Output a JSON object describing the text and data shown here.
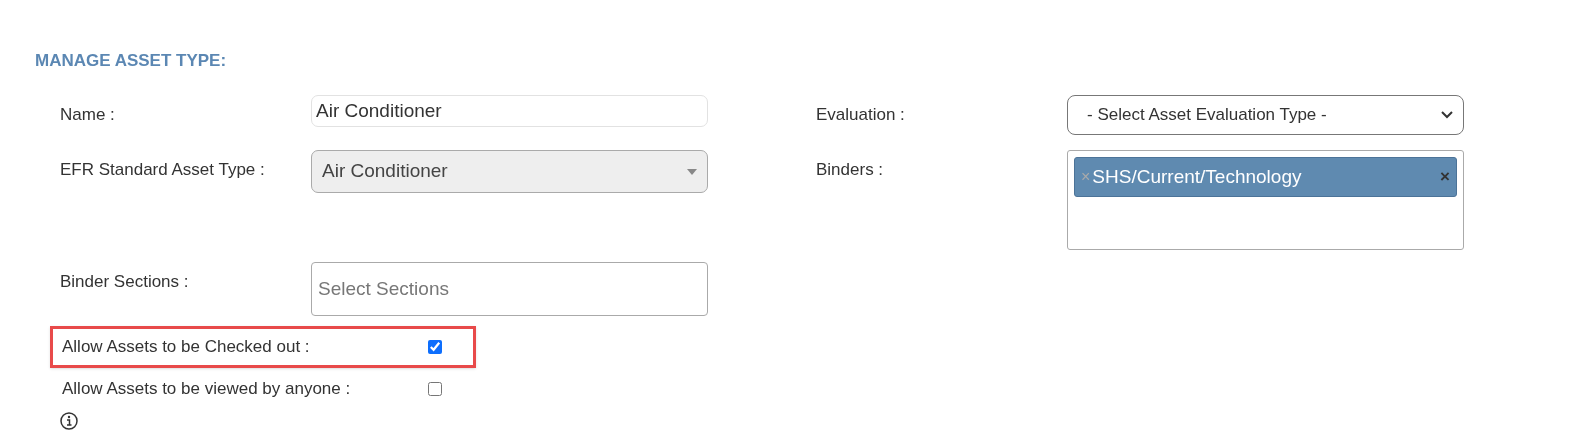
{
  "heading": "MANAGE ASSET TYPE:",
  "left_fields": [
    {
      "kind": "input",
      "label": "Name :",
      "value": "Air Conditioner"
    },
    {
      "kind": "select",
      "label": "EFR Standard Asset Type :",
      "value": "Air Conditioner",
      "disabled": true
    },
    {
      "kind": "multiselect",
      "label": "Binder Sections :",
      "placeholder": "Select Sections"
    }
  ],
  "right_fields": [
    {
      "kind": "select",
      "label": "Evaluation :",
      "value": "- Select Asset Evaluation Type -",
      "disabled": false
    },
    {
      "kind": "tags",
      "label": "Binders :",
      "tags": [
        {
          "remove": "×",
          "label": "SHS/Current/Technology",
          "clear": "×"
        }
      ]
    }
  ],
  "checkboxes": [
    {
      "label": "Allow Assets to be Checked out :",
      "checked": true,
      "highlighted": true
    },
    {
      "label": "Allow Assets to be viewed by anyone :",
      "checked": false,
      "highlighted": false
    }
  ]
}
